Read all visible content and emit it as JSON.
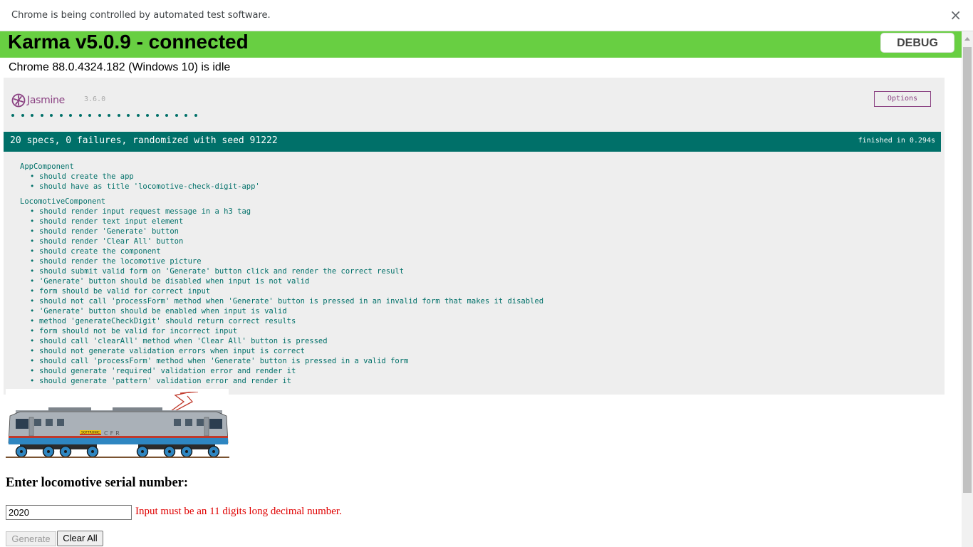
{
  "infobar": {
    "text": "Chrome is being controlled by automated test software.",
    "close_icon": "×"
  },
  "karma": {
    "title": "Karma v5.0.9 - connected",
    "debug_label": "DEBUG",
    "browser_status": "Chrome 88.0.4324.182 (Windows 10) is idle",
    "banner_color": "#68cf42"
  },
  "jasmine": {
    "logo_text": "Jasmine",
    "version": "3.6.0",
    "options_label": "Options",
    "spec_dot_count": 20,
    "summary": "20 specs, 0 failures, randomized with seed 91222",
    "duration": "finished in 0.294s",
    "accent_color": "#007069",
    "suites": [
      {
        "name": "AppComponent",
        "specs": [
          "should create the app",
          "should have as title 'locomotive-check-digit-app'"
        ]
      },
      {
        "name": "LocomotiveComponent",
        "specs": [
          "should render input request message in a h3 tag",
          "should render text input element",
          "should render 'Generate' button",
          "should render 'Clear All' button",
          "should create the component",
          "should render the locomotive picture",
          "should submit valid form on 'Generate' button click and render the correct result",
          "'Generate' button should be disabled when input is not valid",
          "form should be valid for correct input",
          "should not call 'processForm' method when 'Generate' button is pressed in an invalid form that makes it disabled",
          "'Generate' button should be enabled when input is valid",
          "method 'generateCheckDigit' should return correct results",
          "form should not be valid for incorrect input",
          "should call 'clearAll' method when 'Clear All' button is pressed",
          "should not generate validation errors when input is correct",
          "should call 'processForm' method when 'Generate' button is pressed in a valid form",
          "should generate 'required' validation error and render it",
          "should generate 'pattern' validation error and render it"
        ]
      }
    ]
  },
  "app": {
    "locomotive_logo_text": "CFR",
    "locomotive_brand": "SOFTRONIC",
    "heading": "Enter locomotive serial number:",
    "input_value": "2020",
    "error": "Input must be an 11 digits long decimal number.",
    "generate_label": "Generate",
    "clear_label": "Clear All",
    "error_color": "#e00000"
  }
}
